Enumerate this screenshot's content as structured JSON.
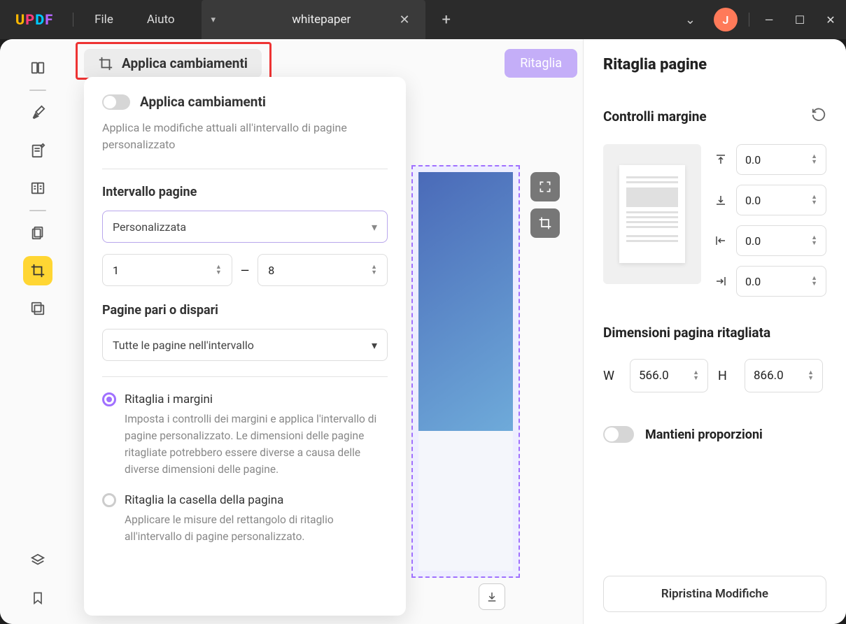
{
  "titlebar": {
    "logo": {
      "u": "U",
      "p": "P",
      "d": "D",
      "f": "F"
    },
    "menu_file": "File",
    "menu_help": "Aiuto",
    "tab_title": "whitepaper",
    "avatar_letter": "J"
  },
  "apply_button": "Applica cambiamenti",
  "crop_button": "Ritaglia",
  "popover": {
    "title": "Applica cambiamenti",
    "desc": "Applica le modifiche attuali all'intervallo di pagine personalizzato",
    "interval_label": "Intervallo pagine",
    "interval_select": "Personalizzata",
    "from": "1",
    "to": "8",
    "odd_even_label": "Pagine pari o dispari",
    "odd_even_select": "Tutte le pagine nell'intervallo",
    "radio1_label": "Ritaglia i margini",
    "radio1_desc": "Imposta i controlli dei margini e applica l'intervallo di pagine personalizzato. Le dimensioni delle pagine ritagliate potrebbero essere diverse a causa delle diverse dimensioni delle pagine.",
    "radio2_label": "Ritaglia la casella della pagina",
    "radio2_desc": "Applicare le misure del rettangolo di ritaglio all'intervallo di pagine personalizzato."
  },
  "rpanel": {
    "title": "Ritaglia pagine",
    "margin_label": "Controlli margine",
    "m_top": "0.0",
    "m_bottom": "0.0",
    "m_left": "0.0",
    "m_right": "0.0",
    "dim_label": "Dimensioni pagina ritagliata",
    "w_label": "W",
    "w_value": "566.0",
    "h_label": "H",
    "h_value": "866.0",
    "keep_label": "Mantieni proporzioni",
    "restore": "Ripristina Modifiche"
  }
}
